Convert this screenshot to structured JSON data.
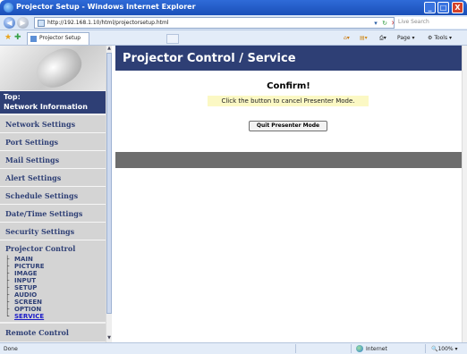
{
  "window": {
    "title": "Projector Setup - Windows Internet Explorer",
    "controls": {
      "minimize": "_",
      "maximize": "□",
      "close": "X"
    }
  },
  "addressbar": {
    "url": "http://192.168.1.10/html/projectorsetup.html",
    "search_placeholder": "Live Search"
  },
  "tabbar": {
    "tab_label": "Projector Setup",
    "commands": {
      "page": "Page",
      "tools": "Tools"
    }
  },
  "sidebar": {
    "top_item": {
      "line1": "Top:",
      "line2": "Network Information"
    },
    "items": [
      "Network Settings",
      "Port Settings",
      "Mail Settings",
      "Alert Settings",
      "Schedule Settings",
      "Date/Time Settings",
      "Security Settings"
    ],
    "projector_control": {
      "label": "Projector Control",
      "subitems": [
        "MAIN",
        "PICTURE",
        "IMAGE",
        "INPUT",
        "SETUP",
        "AUDIO",
        "SCREEN",
        "OPTION",
        "SERVICE"
      ],
      "active": "SERVICE"
    },
    "remote_control": "Remote Control"
  },
  "main": {
    "header": "Projector Control / Service",
    "confirm_title": "Confirm!",
    "message": "Click the button to cancel Presenter Mode.",
    "button_label": "Quit Presenter Mode"
  },
  "statusbar": {
    "left": "Done",
    "zone": "Internet",
    "zoom": "100%"
  },
  "colors": {
    "nav_dark": "#2e3f75",
    "menu_bg": "#d4d4d4",
    "message_bg": "#fbf8c4",
    "divider": "#6d6d6d",
    "active_link": "#1a1ac8"
  },
  "icons": [
    "ie-logo-icon",
    "back-arrow-icon",
    "forward-arrow-icon",
    "refresh-icon",
    "stop-icon",
    "search-icon",
    "favorites-star-icon",
    "add-favorites-icon",
    "home-icon",
    "feeds-icon",
    "print-icon",
    "page-icon",
    "tools-icon",
    "globe-icon"
  ]
}
